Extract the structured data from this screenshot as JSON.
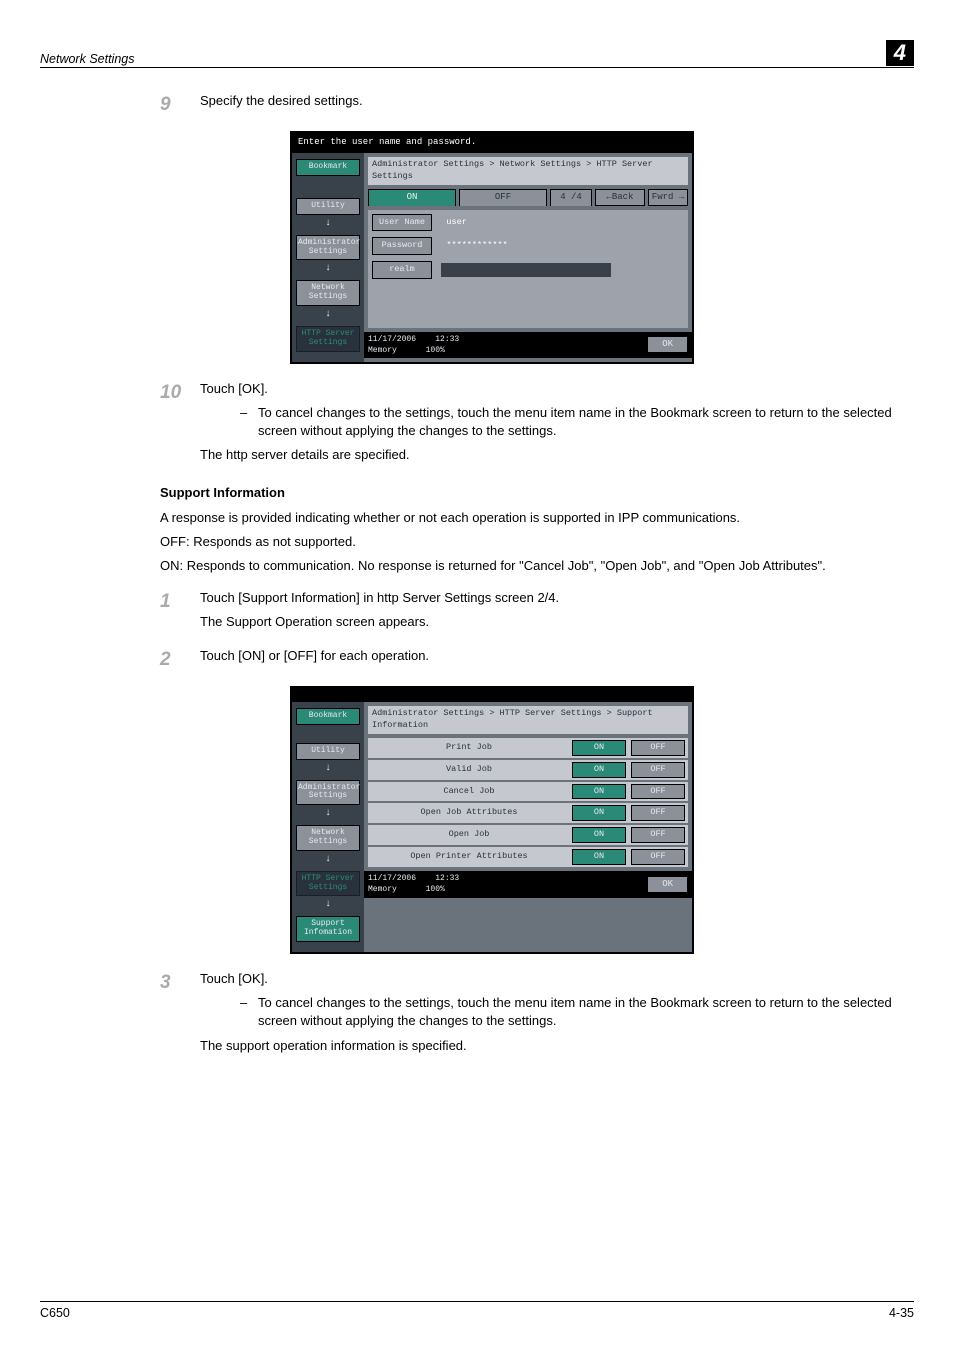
{
  "header": {
    "section": "Network Settings",
    "chapter": "4"
  },
  "s9": {
    "num": "9",
    "text": "Specify the desired settings.",
    "ss": {
      "top": "Enter the user name and password.",
      "breadcrumb": "Administrator Settings > Network Settings > HTTP Server Settings",
      "tabs": {
        "on": "ON",
        "off": "OFF",
        "page": "4 /4",
        "back": "←Back",
        "fwd": "Fwrd →"
      },
      "side": {
        "bookmark": "Bookmark",
        "utility": "Utility",
        "admin": "Administrator Settings",
        "network": "Network Settings",
        "http": "HTTP Server Settings"
      },
      "rows": {
        "user_l": "User Name",
        "user_v": "user",
        "pw_l": "Password",
        "pw_v": "************",
        "realm_l": "realm",
        "realm_v": ""
      },
      "footer": {
        "date": "11/17/2006",
        "time": "12:33",
        "mem": "Memory",
        "memv": "100%",
        "ok": "OK"
      }
    }
  },
  "s10": {
    "num": "10",
    "text": "Touch [OK].",
    "dash": "To cancel changes to the settings, touch the menu item name in the Bookmark screen to return to the selected screen without applying the changes to the settings.",
    "after": "The http server details are specified."
  },
  "support": {
    "heading": "Support Information",
    "p1": "A response is provided indicating whether or not each operation is supported in IPP communications.",
    "p2": "OFF: Responds as not supported.",
    "p3": "ON: Responds to communication. No response is returned for \"Cancel Job\", \"Open Job\", and \"Open Job Attributes\"."
  },
  "s1": {
    "num": "1",
    "text": "Touch [Support Information] in http Server Settings screen 2/4.",
    "after": "The Support Operation screen appears."
  },
  "s2": {
    "num": "2",
    "text": "Touch [ON] or [OFF] for each operation.",
    "ss": {
      "breadcrumb": "Administrator Settings > HTTP Server Settings > Support Information",
      "side": {
        "bookmark": "Bookmark",
        "utility": "Utility",
        "admin": "Administrator Settings",
        "network": "Network Settings",
        "http": "HTTP Server Settings",
        "support": "Support Infomation"
      },
      "rows": [
        {
          "label": "Print Job",
          "on": "ON",
          "off": "OFF"
        },
        {
          "label": "Valid Job",
          "on": "ON",
          "off": "OFF"
        },
        {
          "label": "Cancel Job",
          "on": "ON",
          "off": "OFF"
        },
        {
          "label": "Open Job Attributes",
          "on": "ON",
          "off": "OFF"
        },
        {
          "label": "Open Job",
          "on": "ON",
          "off": "OFF"
        },
        {
          "label": "Open Printer Attributes",
          "on": "ON",
          "off": "OFF"
        }
      ],
      "footer": {
        "date": "11/17/2006",
        "time": "12:33",
        "mem": "Memory",
        "memv": "100%",
        "ok": "OK"
      }
    }
  },
  "s3": {
    "num": "3",
    "text": "Touch [OK].",
    "dash": "To cancel changes to the settings, touch the menu item name in the Bookmark screen to return to the selected screen without applying the changes to the settings.",
    "after": "The support operation information is specified."
  },
  "footer": {
    "model": "C650",
    "page": "4-35"
  }
}
